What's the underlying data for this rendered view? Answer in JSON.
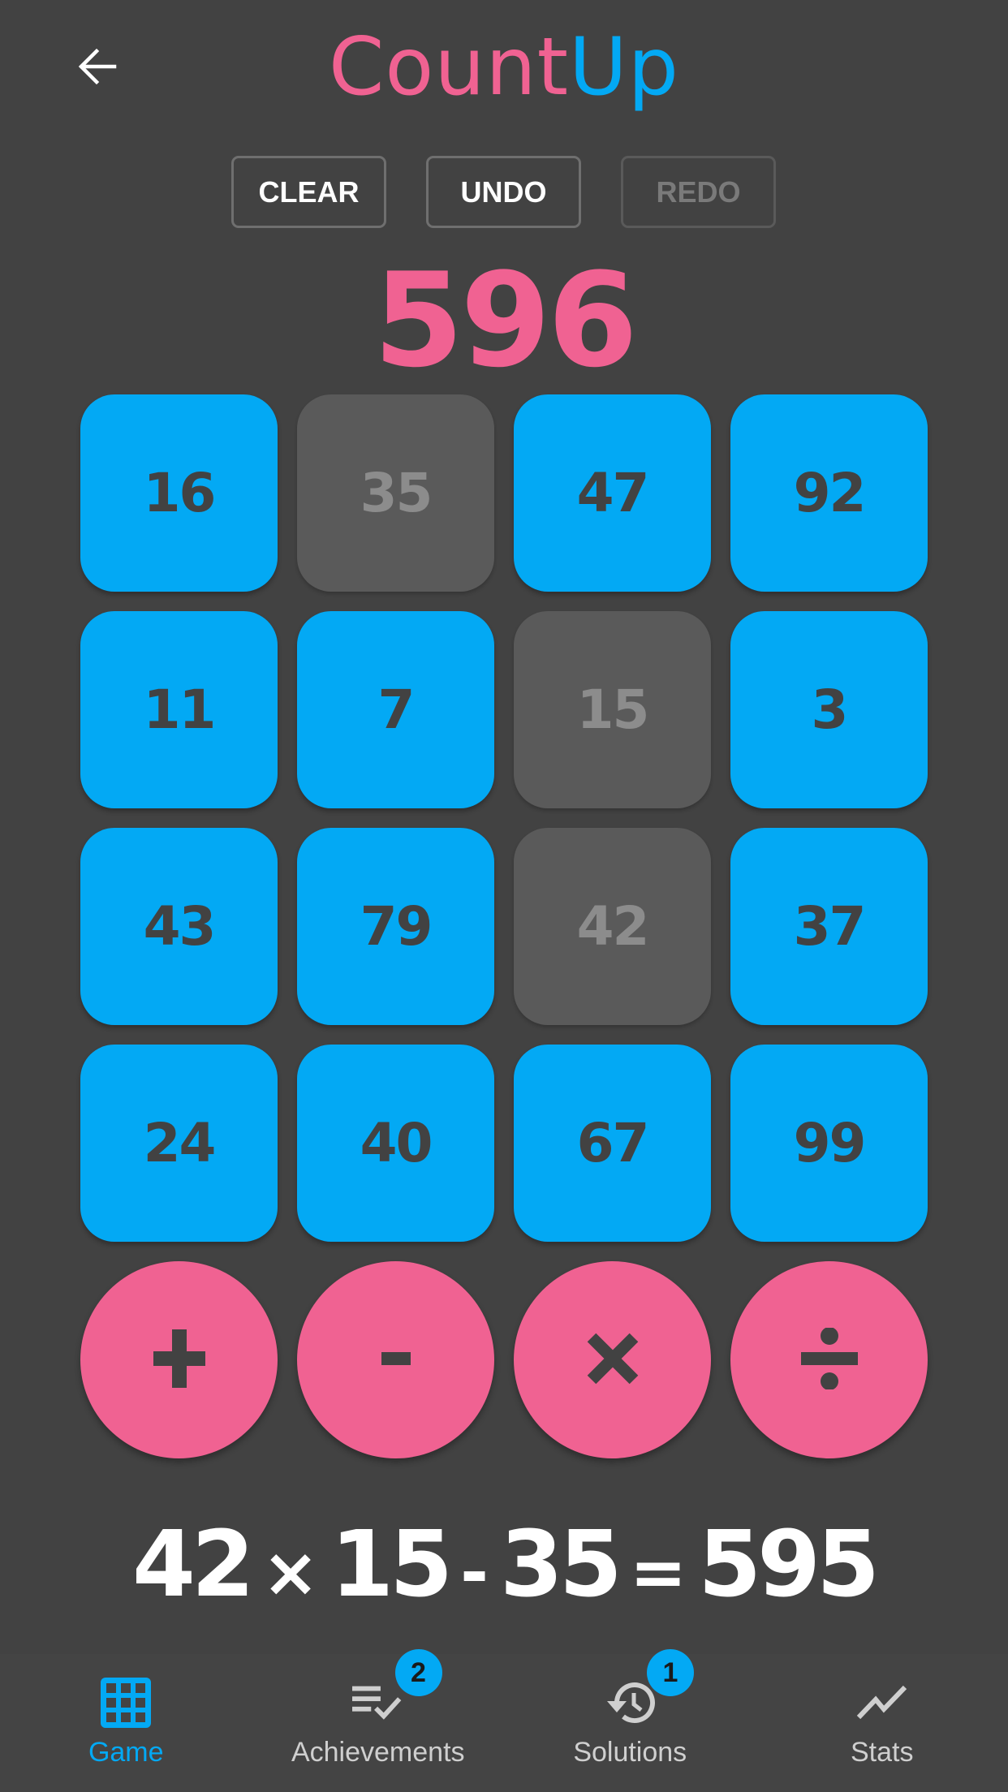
{
  "app": {
    "title_part1": "Count",
    "title_part2": "Up",
    "colors": {
      "background": "#424242",
      "pink": "#F06292",
      "blue": "#03A9F4",
      "used_tile": "#5A5A5A"
    }
  },
  "header": {
    "back_icon": "arrow-left-icon"
  },
  "controls": {
    "clear_label": "CLEAR",
    "undo_label": "UNDO",
    "redo_label": "REDO",
    "redo_disabled": true
  },
  "game": {
    "target": "596",
    "tiles": [
      {
        "value": "16",
        "used": false
      },
      {
        "value": "35",
        "used": true
      },
      {
        "value": "47",
        "used": false
      },
      {
        "value": "92",
        "used": false
      },
      {
        "value": "11",
        "used": false
      },
      {
        "value": "7",
        "used": false
      },
      {
        "value": "15",
        "used": true
      },
      {
        "value": "3",
        "used": false
      },
      {
        "value": "43",
        "used": false
      },
      {
        "value": "79",
        "used": false
      },
      {
        "value": "42",
        "used": true
      },
      {
        "value": "37",
        "used": false
      },
      {
        "value": "24",
        "used": false
      },
      {
        "value": "40",
        "used": false
      },
      {
        "value": "67",
        "used": false
      },
      {
        "value": "99",
        "used": false
      }
    ],
    "operators": [
      {
        "name": "add",
        "icon": "plus-icon"
      },
      {
        "name": "subtract",
        "icon": "minus-icon"
      },
      {
        "name": "multiply",
        "icon": "multiply-icon"
      },
      {
        "name": "divide",
        "icon": "divide-icon"
      }
    ],
    "equation": {
      "operand1": "42",
      "op1": "×",
      "operand2": "15",
      "op2": "-",
      "operand3": "35",
      "equals": "=",
      "result": "595"
    }
  },
  "bottom_nav": {
    "items": [
      {
        "label": "Game",
        "icon": "grid-icon",
        "active": true
      },
      {
        "label": "Achievements",
        "icon": "checklist-icon",
        "badge": "2"
      },
      {
        "label": "Solutions",
        "icon": "history-icon",
        "badge": "1"
      },
      {
        "label": "Stats",
        "icon": "trending-icon"
      }
    ]
  }
}
